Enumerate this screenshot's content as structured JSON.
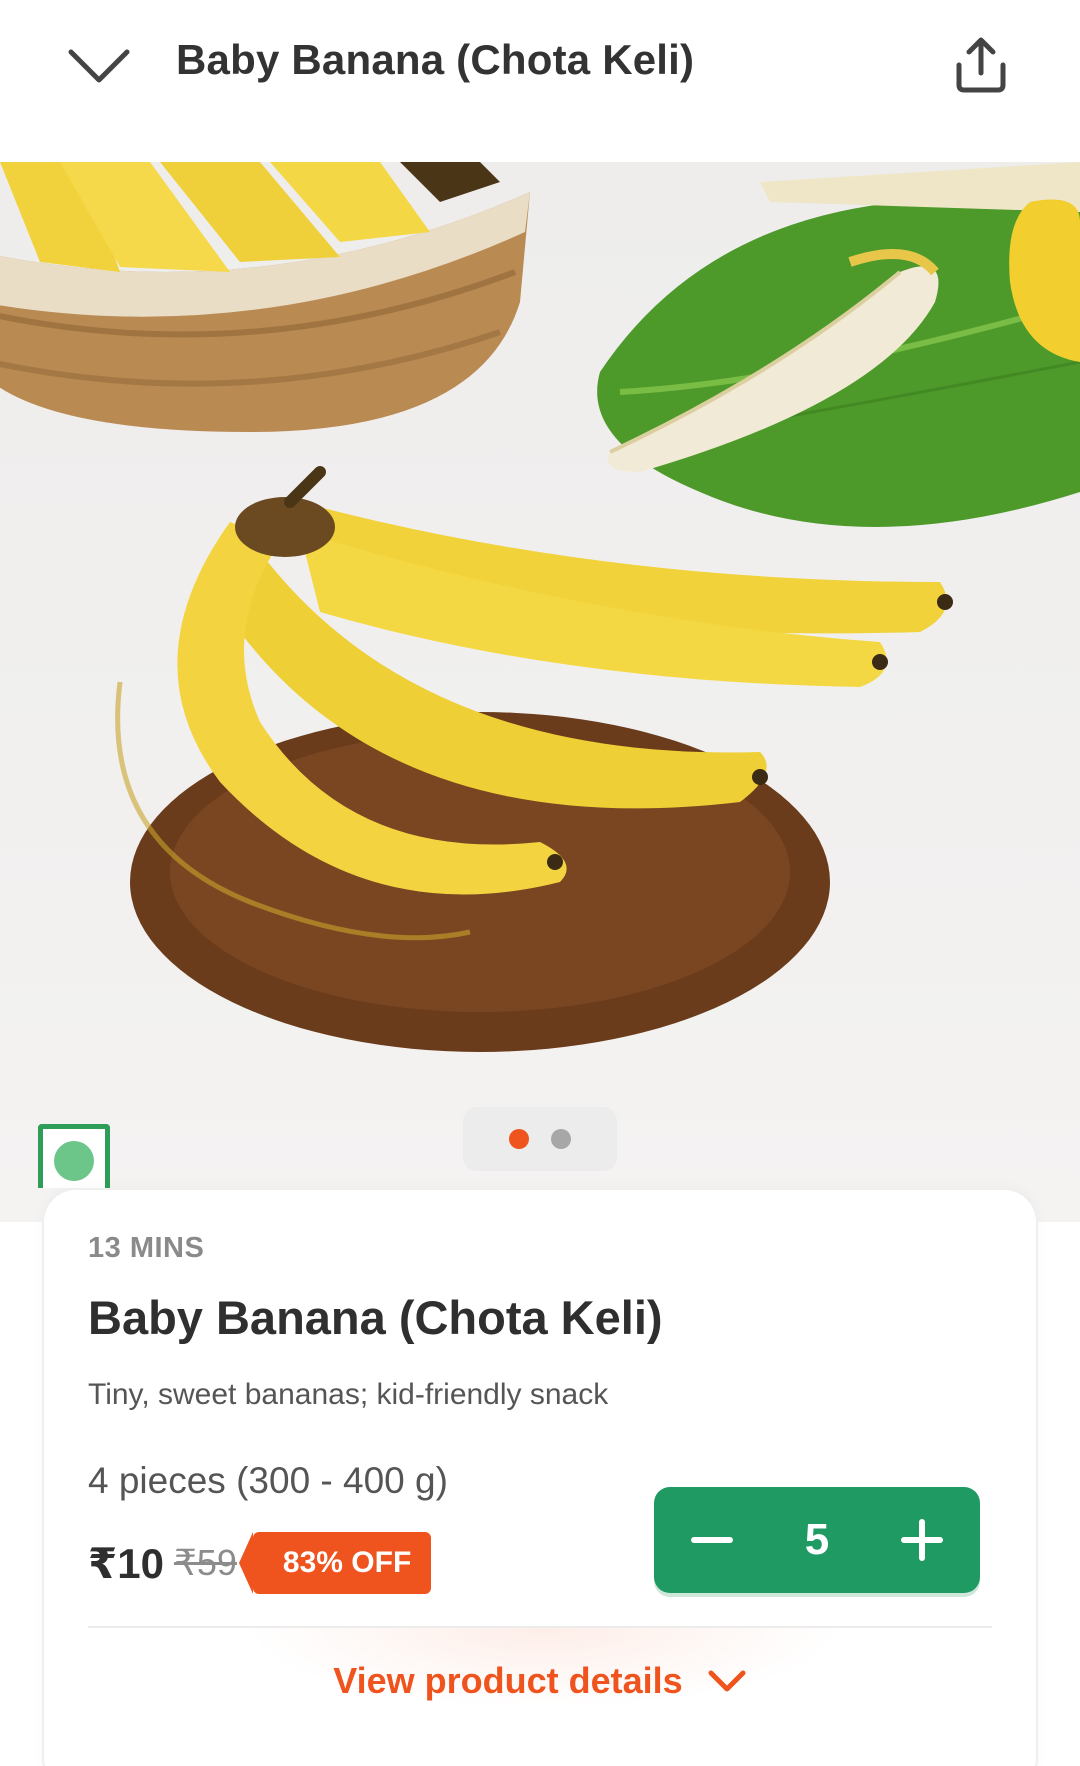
{
  "header": {
    "title": "Baby Banana (Chota Keli)",
    "back_icon": "chevron-down-icon",
    "share_icon": "share-icon"
  },
  "gallery": {
    "image_count": 2,
    "active_index": 0
  },
  "product": {
    "eta": "13 MINS",
    "name": "Baby Banana (Chota Keli)",
    "description": "Tiny, sweet bananas; kid-friendly snack",
    "quantity": "4 pieces (300 - 400 g)",
    "price": "₹10",
    "mrp": "₹59",
    "discount": "83% OFF",
    "veg": true
  },
  "cart": {
    "count": "5",
    "decrement_icon": "minus-icon",
    "increment_icon": "plus-icon"
  },
  "details": {
    "label": "View product details",
    "icon": "chevron-down-icon"
  },
  "colors": {
    "accent": "#f0541e",
    "stepper": "#1f9a63",
    "veg": "#2e9d58"
  }
}
